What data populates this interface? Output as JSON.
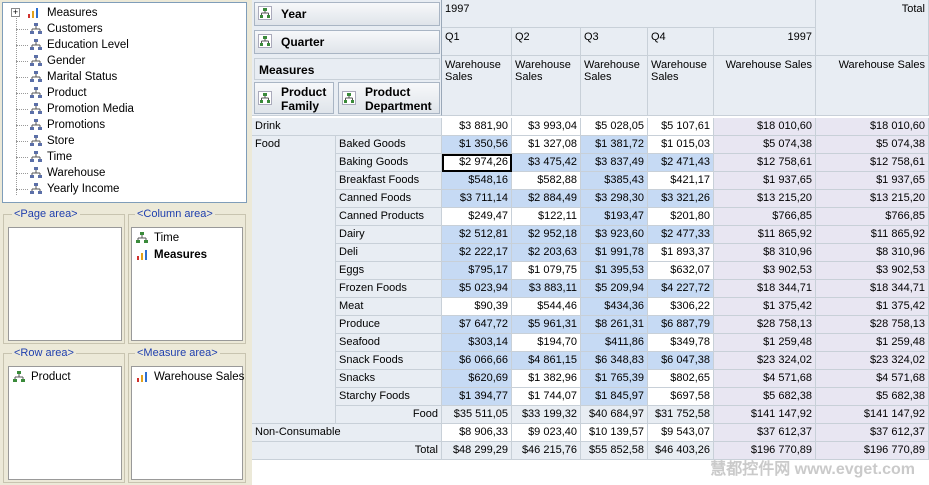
{
  "field_list": {
    "root": "Measures",
    "items": [
      "Customers",
      "Education Level",
      "Gender",
      "Marital Status",
      "Product",
      "Promotion Media",
      "Promotions",
      "Store",
      "Time",
      "Warehouse",
      "Yearly Income"
    ]
  },
  "areas": {
    "page": {
      "title": "<Page area>",
      "items": []
    },
    "column": {
      "title": "<Column area>",
      "items": [
        "Time",
        "Measures"
      ]
    },
    "row": {
      "title": "<Row area>",
      "items": [
        "Product"
      ]
    },
    "measure": {
      "title": "<Measure area>",
      "items": [
        "Warehouse Sales"
      ]
    }
  },
  "pivot": {
    "year_btn": "Year",
    "quarter_btn": "Quarter",
    "measures_btn": "Measures",
    "family_btn_l1": "Product",
    "family_btn_l2": "Family",
    "dept_btn_l1": "Product",
    "dept_btn_l2": "Department",
    "year_value": "1997",
    "total_label": "Total",
    "quarters": [
      "Q1",
      "Q2",
      "Q3",
      "Q4"
    ],
    "year_total": "1997",
    "measure_label": "Warehouse Sales",
    "measure_l1": "Warehouse",
    "measure_l2": "Sales",
    "rows": [
      {
        "family": "Drink",
        "dept": "",
        "v": [
          "$3 881,90",
          "$3 993,04",
          "$5 028,05",
          "$5 107,61",
          "$18 010,60",
          "$18 010,60"
        ]
      },
      {
        "family": "Food",
        "dept": "Baked Goods",
        "v": [
          "$1 350,56",
          "$1 327,08",
          "$1 381,72",
          "$1 015,03",
          "$5 074,38",
          "$5 074,38"
        ]
      },
      {
        "family": "",
        "dept": "Baking Goods",
        "v": [
          "$2 974,26",
          "$3 475,42",
          "$3 837,49",
          "$2 471,43",
          "$12 758,61",
          "$12 758,61"
        ]
      },
      {
        "family": "",
        "dept": "Breakfast Foods",
        "v": [
          "$548,16",
          "$582,88",
          "$385,43",
          "$421,17",
          "$1 937,65",
          "$1 937,65"
        ]
      },
      {
        "family": "",
        "dept": "Canned Foods",
        "v": [
          "$3 711,14",
          "$2 884,49",
          "$3 298,30",
          "$3 321,26",
          "$13 215,20",
          "$13 215,20"
        ]
      },
      {
        "family": "",
        "dept": "Canned Products",
        "v": [
          "$249,47",
          "$122,11",
          "$193,47",
          "$201,80",
          "$766,85",
          "$766,85"
        ]
      },
      {
        "family": "",
        "dept": "Dairy",
        "v": [
          "$2 512,81",
          "$2 952,18",
          "$3 923,60",
          "$2 477,33",
          "$11 865,92",
          "$11 865,92"
        ]
      },
      {
        "family": "",
        "dept": "Deli",
        "v": [
          "$2 222,17",
          "$2 203,63",
          "$1 991,78",
          "$1 893,37",
          "$8 310,96",
          "$8 310,96"
        ]
      },
      {
        "family": "",
        "dept": "Eggs",
        "v": [
          "$795,17",
          "$1 079,75",
          "$1 395,53",
          "$632,07",
          "$3 902,53",
          "$3 902,53"
        ]
      },
      {
        "family": "",
        "dept": "Frozen Foods",
        "v": [
          "$5 023,94",
          "$3 883,11",
          "$5 209,94",
          "$4 227,72",
          "$18 344,71",
          "$18 344,71"
        ]
      },
      {
        "family": "",
        "dept": "Meat",
        "v": [
          "$90,39",
          "$544,46",
          "$434,36",
          "$306,22",
          "$1 375,42",
          "$1 375,42"
        ]
      },
      {
        "family": "",
        "dept": "Produce",
        "v": [
          "$7 647,72",
          "$5 961,31",
          "$8 261,31",
          "$6 887,79",
          "$28 758,13",
          "$28 758,13"
        ]
      },
      {
        "family": "",
        "dept": "Seafood",
        "v": [
          "$303,14",
          "$194,70",
          "$411,86",
          "$349,78",
          "$1 259,48",
          "$1 259,48"
        ]
      },
      {
        "family": "",
        "dept": "Snack Foods",
        "v": [
          "$6 066,66",
          "$4 861,15",
          "$6 348,83",
          "$6 047,38",
          "$23 324,02",
          "$23 324,02"
        ]
      },
      {
        "family": "",
        "dept": "Snacks",
        "v": [
          "$620,69",
          "$1 382,96",
          "$1 765,39",
          "$802,65",
          "$4 571,68",
          "$4 571,68"
        ]
      },
      {
        "family": "",
        "dept": "Starchy Foods",
        "v": [
          "$1 394,77",
          "$1 744,07",
          "$1 845,97",
          "$697,58",
          "$5 682,38",
          "$5 682,38"
        ]
      },
      {
        "family": "",
        "dept": "Food",
        "v": [
          "$35 511,05",
          "$33 199,32",
          "$40 684,97",
          "$31 752,58",
          "$141 147,92",
          "$141 147,92"
        ],
        "subtotal": true
      },
      {
        "family": "Non-Consumable",
        "dept": "",
        "v": [
          "$8 906,33",
          "$9 023,40",
          "$10 139,57",
          "$9 543,07",
          "$37 612,37",
          "$37 612,37"
        ]
      },
      {
        "family": "",
        "dept": "Total",
        "v": [
          "$48 299,29",
          "$46 215,76",
          "$55 852,58",
          "$46 403,26",
          "$196 770,89",
          "$196 770,89"
        ],
        "total": true
      }
    ]
  },
  "watermark": "慧都控件网 www.evget.com"
}
